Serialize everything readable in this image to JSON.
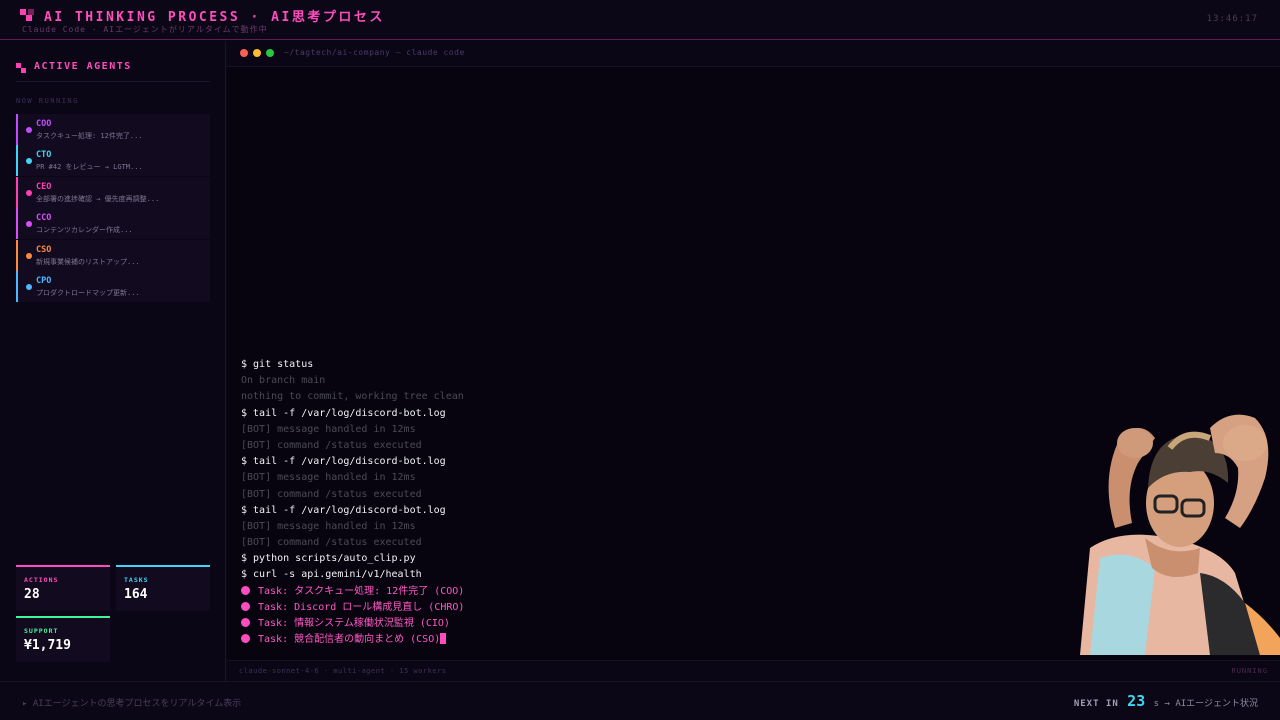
{
  "header": {
    "title": "AI THINKING PROCESS · AI思考プロセス",
    "subtitle": "Claude Code · AIエージェントがリアルタイムで動作中",
    "clock": "13:46:17"
  },
  "sidebar": {
    "title": "ACTIVE AGENTS",
    "running_label": "NOW RUNNING",
    "agents": [
      {
        "name": "COO",
        "task": "タスクキュー処理: 12件完了...",
        "color": "#c24dff"
      },
      {
        "name": "CTO",
        "task": "PR #42 をレビュー → LGTM...",
        "color": "#3fd6f5"
      },
      {
        "name": "CEO",
        "task": "全部署の進捗確認 → 優先度再調整...",
        "color": "#ff3fb4"
      },
      {
        "name": "CCO",
        "task": "コンテンツカレンダー作成...",
        "color": "#d94dff"
      },
      {
        "name": "CSO",
        "task": "新規事業候補のリストアップ...",
        "color": "#ff8a3d"
      },
      {
        "name": "CPO",
        "task": "プロダクトロードマップ更新...",
        "color": "#4db8ff"
      }
    ],
    "stats": {
      "actions": {
        "label": "ACTIONS",
        "value": "28",
        "color": "#ff4dbd"
      },
      "tasks": {
        "label": "TASKS",
        "value": "164",
        "color": "#3fd6f5"
      },
      "support": {
        "label": "SUPPORT",
        "value": "¥1,719",
        "color": "#3df59a"
      }
    }
  },
  "terminal": {
    "path": "~/tagtech/ai-company — claude code",
    "lines": [
      {
        "type": "cmd",
        "text": "$ git status"
      },
      {
        "type": "out",
        "text": "On branch main"
      },
      {
        "type": "out",
        "text": "nothing to commit, working tree clean"
      },
      {
        "type": "cmd",
        "text": "$ tail -f /var/log/discord-bot.log"
      },
      {
        "type": "out",
        "text": "[BOT] message handled in 12ms"
      },
      {
        "type": "out",
        "text": "[BOT] command /status executed"
      },
      {
        "type": "cmd",
        "text": "$ tail -f /var/log/discord-bot.log"
      },
      {
        "type": "out",
        "text": "[BOT] message handled in 12ms"
      },
      {
        "type": "out",
        "text": "[BOT] command /status executed"
      },
      {
        "type": "cmd",
        "text": "$ tail -f /var/log/discord-bot.log"
      },
      {
        "type": "out",
        "text": "[BOT] message handled in 12ms"
      },
      {
        "type": "out",
        "text": "[BOT] command /status executed"
      },
      {
        "type": "cmd",
        "text": "$ python scripts/auto_clip.py"
      },
      {
        "type": "cmd",
        "text": "$ curl -s api.gemini/v1/health"
      },
      {
        "type": "task",
        "text": "Task: タスクキュー処理: 12件完了 (COO)"
      },
      {
        "type": "task",
        "text": "Task: Discord ロール構成見直し (CHRO)"
      },
      {
        "type": "task",
        "text": "Task: 情報システム稼働状況監視 (CIO)"
      },
      {
        "type": "task",
        "text": "Task: 競合配信者の動向まとめ (CSO)"
      }
    ],
    "status_left": "claude-sonnet-4-6 · multi-agent · 15 workers",
    "status_right": "RUNNING"
  },
  "footer": {
    "tip": "▸ AIエージェントの思考プロセスをリアルタイム表示",
    "next_label": "NEXT IN",
    "next_seconds": "23",
    "next_suffix": "s → AIエージェント状況"
  }
}
